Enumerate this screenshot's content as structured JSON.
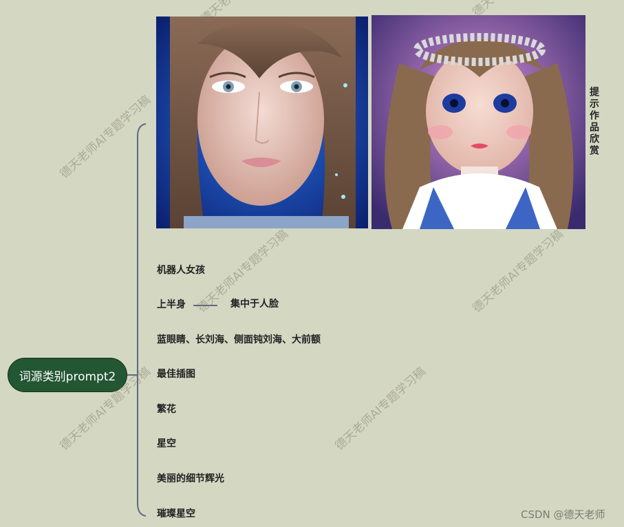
{
  "root": {
    "label": "词源类别prompt2"
  },
  "caption": "提示作品欣赏",
  "branches": [
    {
      "label": "机器人女孩"
    },
    {
      "label": "上半身",
      "child": "集中于人脸"
    },
    {
      "label": "蓝眼睛、长刘海、侧面钝刘海、大前额"
    },
    {
      "label": "最佳插图"
    },
    {
      "label": "繁花"
    },
    {
      "label": "星空"
    },
    {
      "label": "美丽的细节辉光"
    },
    {
      "label": "璀璨星空"
    }
  ],
  "watermark": "德天老师AI专题学习稿",
  "footer": "CSDN @德天老师",
  "colors": {
    "background": "#d4d7c2",
    "root_fill": "#235633",
    "connector": "#5e6a80"
  }
}
